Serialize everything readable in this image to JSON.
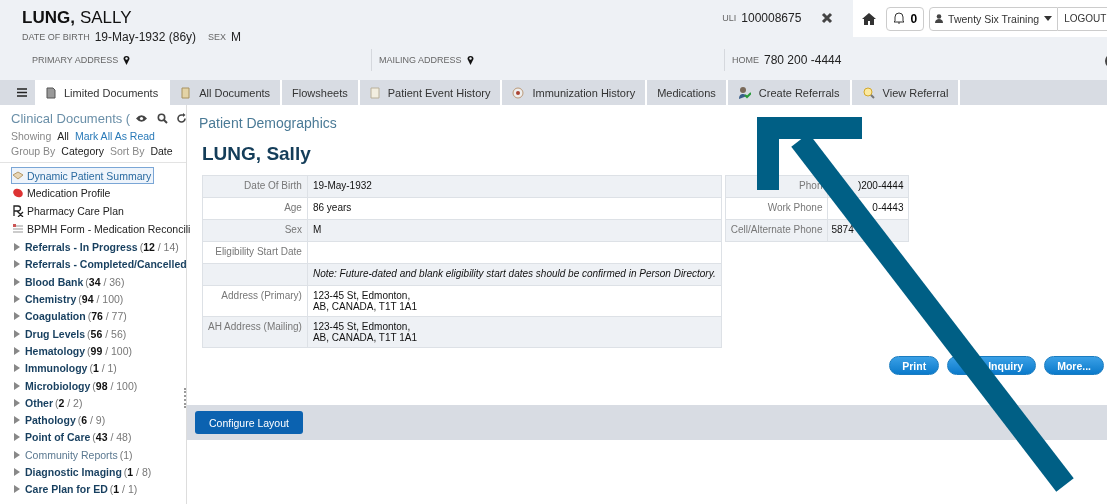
{
  "header": {
    "last_name": "LUNG,",
    "first_name": "SALLY",
    "dob_label": "DATE OF BIRTH",
    "dob": "19-May-1932 (86y)",
    "sex_label": "SEX",
    "sex": "M",
    "uli_label": "ULI",
    "uli": "100008675",
    "primary_address_label": "PRIMARY ADDRESS",
    "mailing_address_label": "MAILING ADDRESS",
    "home_label": "HOME",
    "home": "780 200 -4444"
  },
  "topbar": {
    "notifications": "0",
    "user": "Twenty Six Training",
    "logout": "LOGOUT"
  },
  "tabs": [
    {
      "label": "Limited Documents",
      "kind": "doc",
      "selected": true
    },
    {
      "label": "All Documents",
      "kind": "docs",
      "selected": false
    },
    {
      "label": "Flowsheets",
      "kind": "plain",
      "selected": false
    },
    {
      "label": "Patient Event History",
      "kind": "event",
      "selected": false
    },
    {
      "label": "Immunization History",
      "kind": "immunization",
      "selected": false
    },
    {
      "label": "Medications",
      "kind": "plain",
      "selected": false
    },
    {
      "label": "Create Referrals",
      "kind": "referral",
      "selected": false
    },
    {
      "label": "View Referral",
      "kind": "view",
      "selected": false
    }
  ],
  "sidebar": {
    "title": "Clinical Documents (",
    "showing_label": "Showing",
    "showing": "All",
    "mark_all": "Mark All As Read",
    "group_label": "Group By",
    "group": "Category",
    "sort_label": "Sort By",
    "sort": "Date",
    "items": [
      {
        "label": "Dynamic Patient Summary",
        "kind": "summary",
        "selected": true
      },
      {
        "label": "Medication Profile",
        "kind": "pill",
        "selected": false
      },
      {
        "label": "Pharmacy Care Plan",
        "kind": "rx",
        "selected": false
      },
      {
        "label": "BPMH Form - Medication Reconcili",
        "kind": "form",
        "selected": false
      }
    ],
    "categories": [
      {
        "label": "Referrals - In Progress",
        "count": "(**12** / 14)",
        "enabled": true
      },
      {
        "label": "Referrals - Completed/Cancelled",
        "enabled": true
      },
      {
        "label": "Blood Bank",
        "count": "(**34** / 36)",
        "enabled": true
      },
      {
        "label": "Chemistry",
        "count": "(**94** / 100)",
        "enabled": true
      },
      {
        "label": "Coagulation",
        "count": "(**76** / 77)",
        "enabled": true
      },
      {
        "label": "Drug Levels",
        "count": "(**56** / 56)",
        "enabled": true
      },
      {
        "label": "Hematology",
        "count": "(**99** / 100)",
        "enabled": true
      },
      {
        "label": "Immunology",
        "count": "(**1** / 1)",
        "enabled": true
      },
      {
        "label": "Microbiology",
        "count": "(**98** / 100)",
        "enabled": true
      },
      {
        "label": "Other",
        "count": "(**2** / 2)",
        "enabled": true
      },
      {
        "label": "Pathology",
        "count": "(**6** / 9)",
        "enabled": true
      },
      {
        "label": "Point of Care",
        "count": "(**43** / 48)",
        "enabled": true
      },
      {
        "label": "Community Reports",
        "count": "(1)",
        "enabled": false
      },
      {
        "label": "Diagnostic Imaging",
        "count": "(**1** / 8)",
        "enabled": true
      },
      {
        "label": "Care Plan for ED",
        "count": "(**1** / 1)",
        "enabled": true
      }
    ]
  },
  "content": {
    "section_title": "Patient Demographics",
    "patient_name": "LUNG, Sally",
    "demographics": [
      {
        "label": "Date Of Birth",
        "lines": [
          "19-May-1932"
        ]
      },
      {
        "label": "Age",
        "lines": [
          "86 years"
        ]
      },
      {
        "label": "Sex",
        "lines": [
          "M"
        ]
      },
      {
        "label": "Eligibility Start Date"
      },
      {
        "kind": "note",
        "lines": [
          "Note: Future-dated and blank eligibility start dates should be confirmed in Person Directory."
        ]
      },
      {
        "label": "Address (Primary)",
        "lines": [
          "123-45 St, Edmonton,",
          "AB, CANADA, T1T 1A1"
        ]
      },
      {
        "label": "AH Address (Mailing)",
        "lines": [
          "123-45 St, Edmonton,",
          "AB, CANADA, T1T 1A1"
        ]
      }
    ],
    "phones": [
      {
        "label": "Phon",
        "value": ")200-4444"
      },
      {
        "label": "Work Phone",
        "value": "0-4443"
      },
      {
        "label": "Cell/Alternate Phone",
        "value": "5874"
      }
    ],
    "buttons": [
      "Print",
      "Inquiry",
      "More..."
    ],
    "configure": "Configure Layout"
  }
}
